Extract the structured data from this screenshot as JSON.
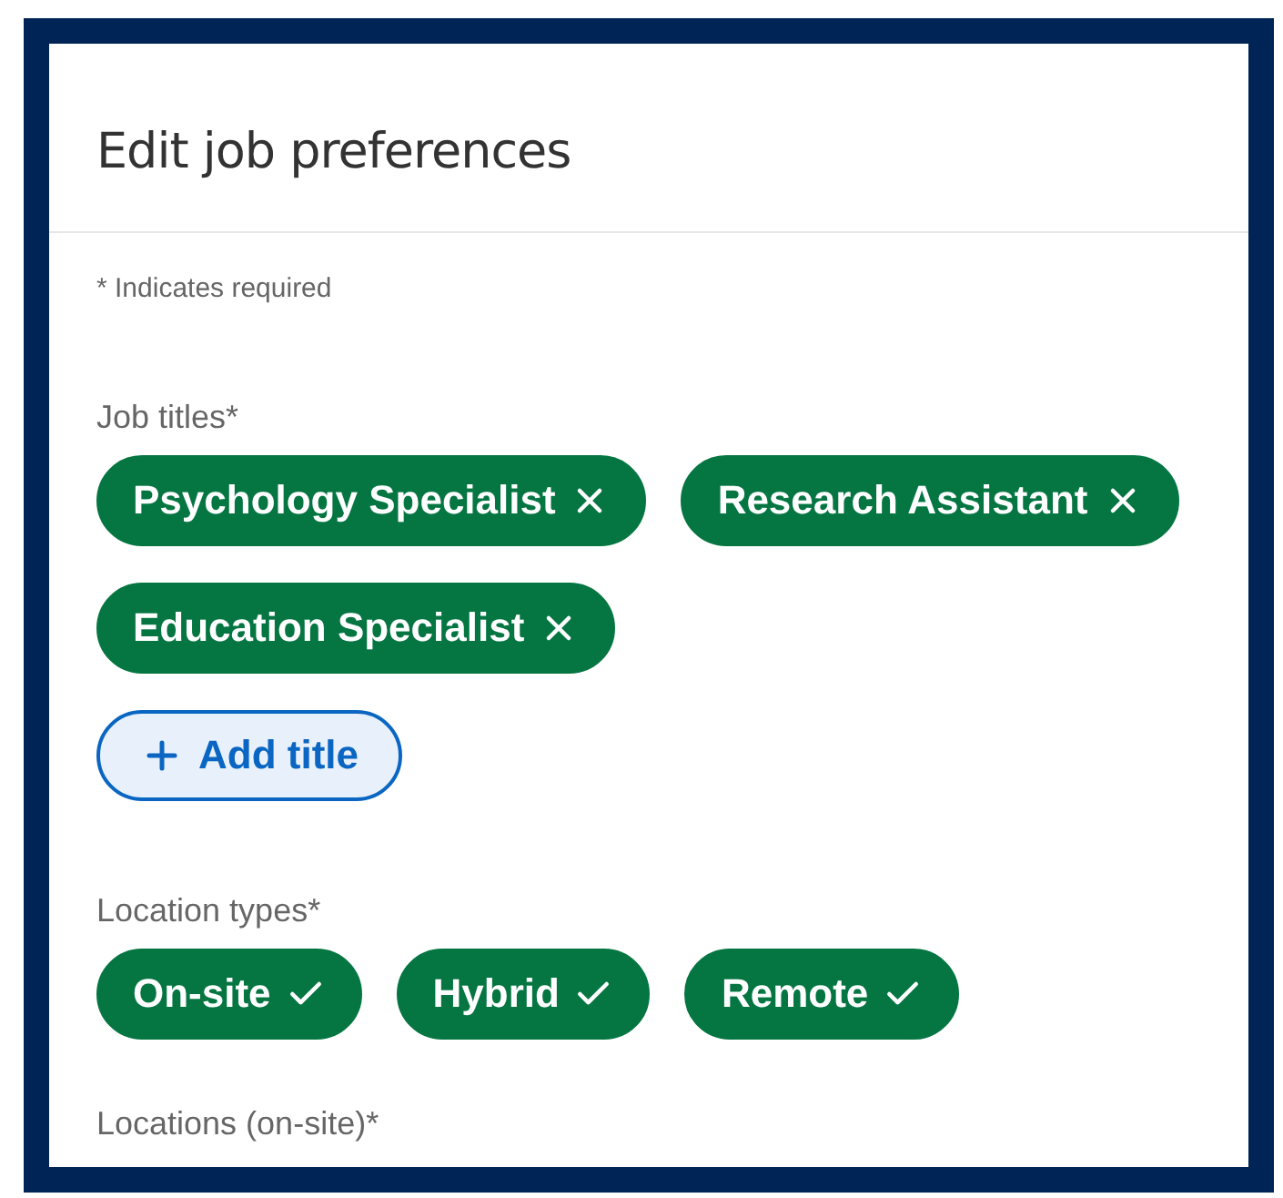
{
  "dialog": {
    "title": "Edit job preferences",
    "required_note": "* Indicates required"
  },
  "job_titles": {
    "label": "Job titles*",
    "items": [
      {
        "label": "Psychology Specialist"
      },
      {
        "label": "Research Assistant"
      },
      {
        "label": "Education Specialist"
      }
    ],
    "add_button": "Add title"
  },
  "location_types": {
    "label": "Location types*",
    "items": [
      {
        "label": "On-site",
        "selected": true
      },
      {
        "label": "Hybrid",
        "selected": true
      },
      {
        "label": "Remote",
        "selected": true
      }
    ]
  },
  "locations": {
    "label": "Locations (on-site)*"
  }
}
